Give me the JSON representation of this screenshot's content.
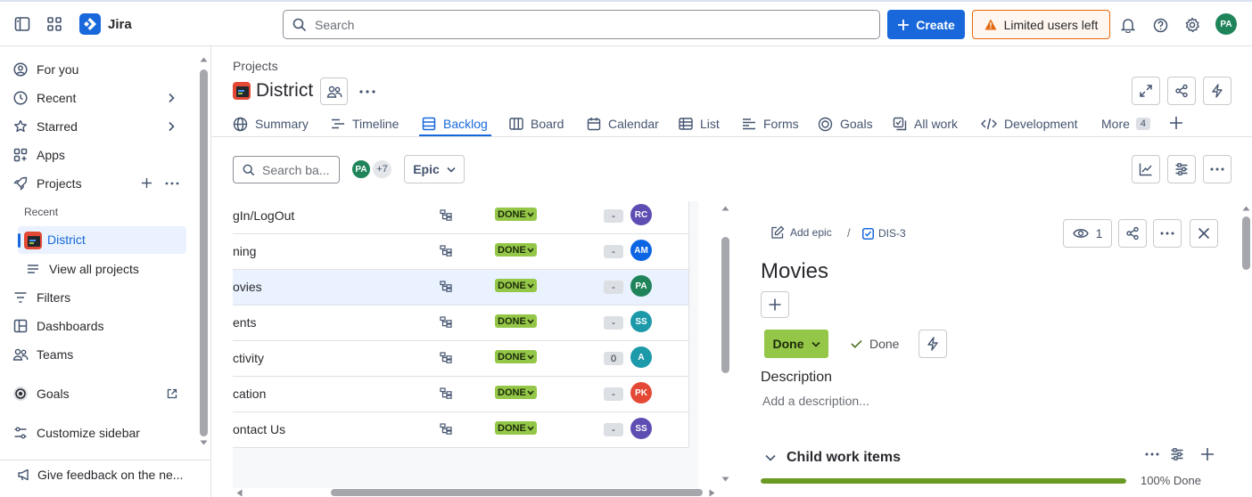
{
  "topbar": {
    "app_name": "Jira",
    "search_placeholder": "Search",
    "create_label": "Create",
    "limited_label": "Limited users left",
    "user_initials": "PA"
  },
  "sidebar": {
    "for_you": "For you",
    "recent": "Recent",
    "starred": "Starred",
    "apps": "Apps",
    "projects": "Projects",
    "recent_heading": "Recent",
    "district": "District",
    "view_all": "View all projects",
    "filters": "Filters",
    "dashboards": "Dashboards",
    "teams": "Teams",
    "goals": "Goals",
    "customize": "Customize sidebar",
    "feedback": "Give feedback on the ne..."
  },
  "project": {
    "breadcrumb": "Projects",
    "name": "District",
    "tabs": {
      "summary": "Summary",
      "timeline": "Timeline",
      "backlog": "Backlog",
      "board": "Board",
      "calendar": "Calendar",
      "list": "List",
      "forms": "Forms",
      "goals": "Goals",
      "all_work": "All work",
      "development": "Development",
      "more": "More",
      "more_count": "4"
    }
  },
  "toolbar": {
    "search_placeholder": "Search ba...",
    "avatar": "PA",
    "extra_count": "+7",
    "epic_label": "Epic"
  },
  "rows": [
    {
      "name": "gIn/LogOut",
      "status": "DONE",
      "estimate": "-",
      "assignee": "RC",
      "color": "#5e4db2"
    },
    {
      "name": "ning",
      "status": "DONE",
      "estimate": "-",
      "assignee": "AM",
      "color": "#0c66e4"
    },
    {
      "name": "ovies",
      "status": "DONE",
      "estimate": "-",
      "assignee": "PA",
      "color": "#1f845a"
    },
    {
      "name": "ents",
      "status": "DONE",
      "estimate": "-",
      "assignee": "SS",
      "color": "#1d9aaa"
    },
    {
      "name": "ctivity",
      "status": "DONE",
      "estimate": "0",
      "assignee": "A",
      "color": "#1d9aaa"
    },
    {
      "name": "cation",
      "status": "DONE",
      "estimate": "-",
      "assignee": "PK",
      "color": "#e34935"
    },
    {
      "name": "ontact Us",
      "status": "DONE",
      "estimate": "-",
      "assignee": "SS",
      "color": "#5e4db2"
    }
  ],
  "detail": {
    "add_epic": "Add epic",
    "separator": "/",
    "key": "DIS-3",
    "watch_count": "1",
    "title": "Movies",
    "status_button": "Done",
    "resolution": "Done",
    "description_heading": "Description",
    "description_placeholder": "Add a description...",
    "child_heading": "Child work items",
    "progress_label": "100% Done",
    "progress_fraction": 1.0
  }
}
